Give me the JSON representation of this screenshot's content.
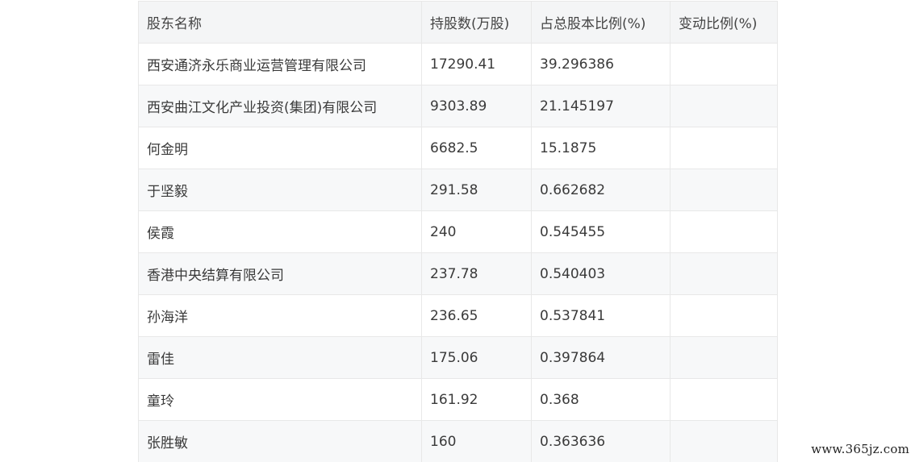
{
  "table": {
    "headers": [
      "股东名称",
      "持股数(万股)",
      "占总股本比例(%)",
      "变动比例(%)"
    ],
    "rows": [
      [
        "西安通济永乐商业运营管理有限公司",
        "17290.41",
        "39.296386",
        ""
      ],
      [
        "西安曲江文化产业投资(集团)有限公司",
        "9303.89",
        "21.145197",
        ""
      ],
      [
        "何金明",
        "6682.5",
        "15.1875",
        ""
      ],
      [
        "于坚毅",
        "291.58",
        "0.662682",
        ""
      ],
      [
        "侯霞",
        "240",
        "0.545455",
        ""
      ],
      [
        "香港中央结算有限公司",
        "237.78",
        "0.540403",
        ""
      ],
      [
        "孙海洋",
        "236.65",
        "0.537841",
        ""
      ],
      [
        "雷佳",
        "175.06",
        "0.397864",
        ""
      ],
      [
        "童玲",
        "161.92",
        "0.368",
        ""
      ],
      [
        "张胜敏",
        "160",
        "0.363636",
        ""
      ]
    ]
  },
  "watermark": "www.365jz.com"
}
